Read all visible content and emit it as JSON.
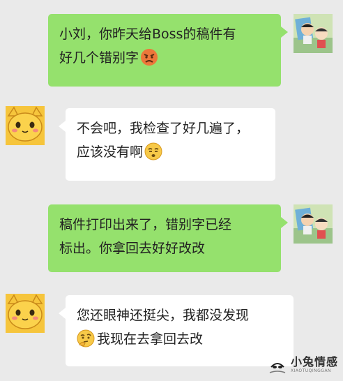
{
  "messages": [
    {
      "side": "sent",
      "lines": [
        "小刘，你昨天给Boss的稿件有",
        "好几个错别字"
      ],
      "emoji": "angry-emoji"
    },
    {
      "side": "received",
      "lines": [
        "不会吧，我检查了好几遍了，",
        "应该没有啊"
      ],
      "emoji": "unamused-emoji"
    },
    {
      "side": "sent",
      "lines": [
        "稿件打印出来了，错别字已经",
        "标出。你拿回去好好改改"
      ]
    },
    {
      "side": "received",
      "lines": [
        "您还眼神还挺尖，我都没发现",
        "我现在去拿回去改"
      ],
      "emoji": "thinking-emoji"
    }
  ],
  "watermark": {
    "title": "小兔情感",
    "subtitle": "XIAOTUQINGGAN"
  },
  "colors": {
    "background": "#eaeaea",
    "sent_bubble": "#95e16d",
    "received_bubble": "#ffffff"
  }
}
